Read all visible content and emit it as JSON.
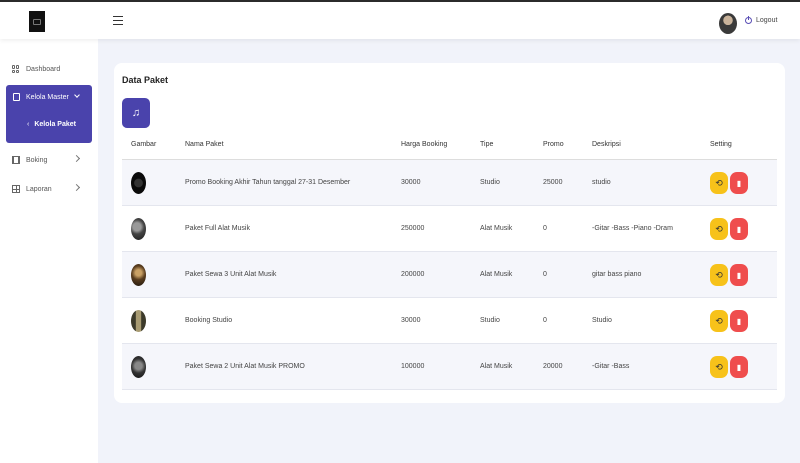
{
  "topbar": {
    "logout_label": "Logout"
  },
  "sidebar": {
    "items": [
      {
        "label": "Dashboard",
        "icon": "grid-icon"
      },
      {
        "label": "Kelola Master",
        "icon": "book-icon"
      },
      {
        "label": "Boking",
        "icon": "columns-icon"
      },
      {
        "label": "Laporan",
        "icon": "table-icon"
      }
    ],
    "sub_item": "Kelola Paket"
  },
  "main": {
    "title": "Data Paket",
    "add_icon": "music-note-icon",
    "table": {
      "headers": [
        "Gambar",
        "Nama Paket",
        "Harga Booking",
        "Tipe",
        "Promo",
        "Deskripsi",
        "Setting"
      ],
      "rows": [
        {
          "nama": "Promo Booking Akhir Tahun tanggal 27-31 Desember",
          "harga": "30000",
          "tipe": "Studio",
          "promo": "25000",
          "deskripsi": "studio"
        },
        {
          "nama": "Paket Full Alat Musik",
          "harga": "250000",
          "tipe": "Alat Musik",
          "promo": "0",
          "deskripsi": "-Gitar -Bass -Piano -Dram"
        },
        {
          "nama": "Paket Sewa 3 Unit Alat Musik",
          "harga": "200000",
          "tipe": "Alat Musik",
          "promo": "0",
          "deskripsi": "gitar bass piano"
        },
        {
          "nama": "Booking Studio",
          "harga": "30000",
          "tipe": "Studio",
          "promo": "0",
          "deskripsi": "Studio"
        },
        {
          "nama": "Paket Sewa 2 Unit Alat Musik PROMO",
          "harga": "100000",
          "tipe": "Alat Musik",
          "promo": "20000",
          "deskripsi": "-Gitar -Bass"
        }
      ]
    }
  },
  "colors": {
    "primary": "#4a43ac",
    "edit": "#f7c21a",
    "delete": "#ef4d4d",
    "background": "#f1f3fa"
  }
}
